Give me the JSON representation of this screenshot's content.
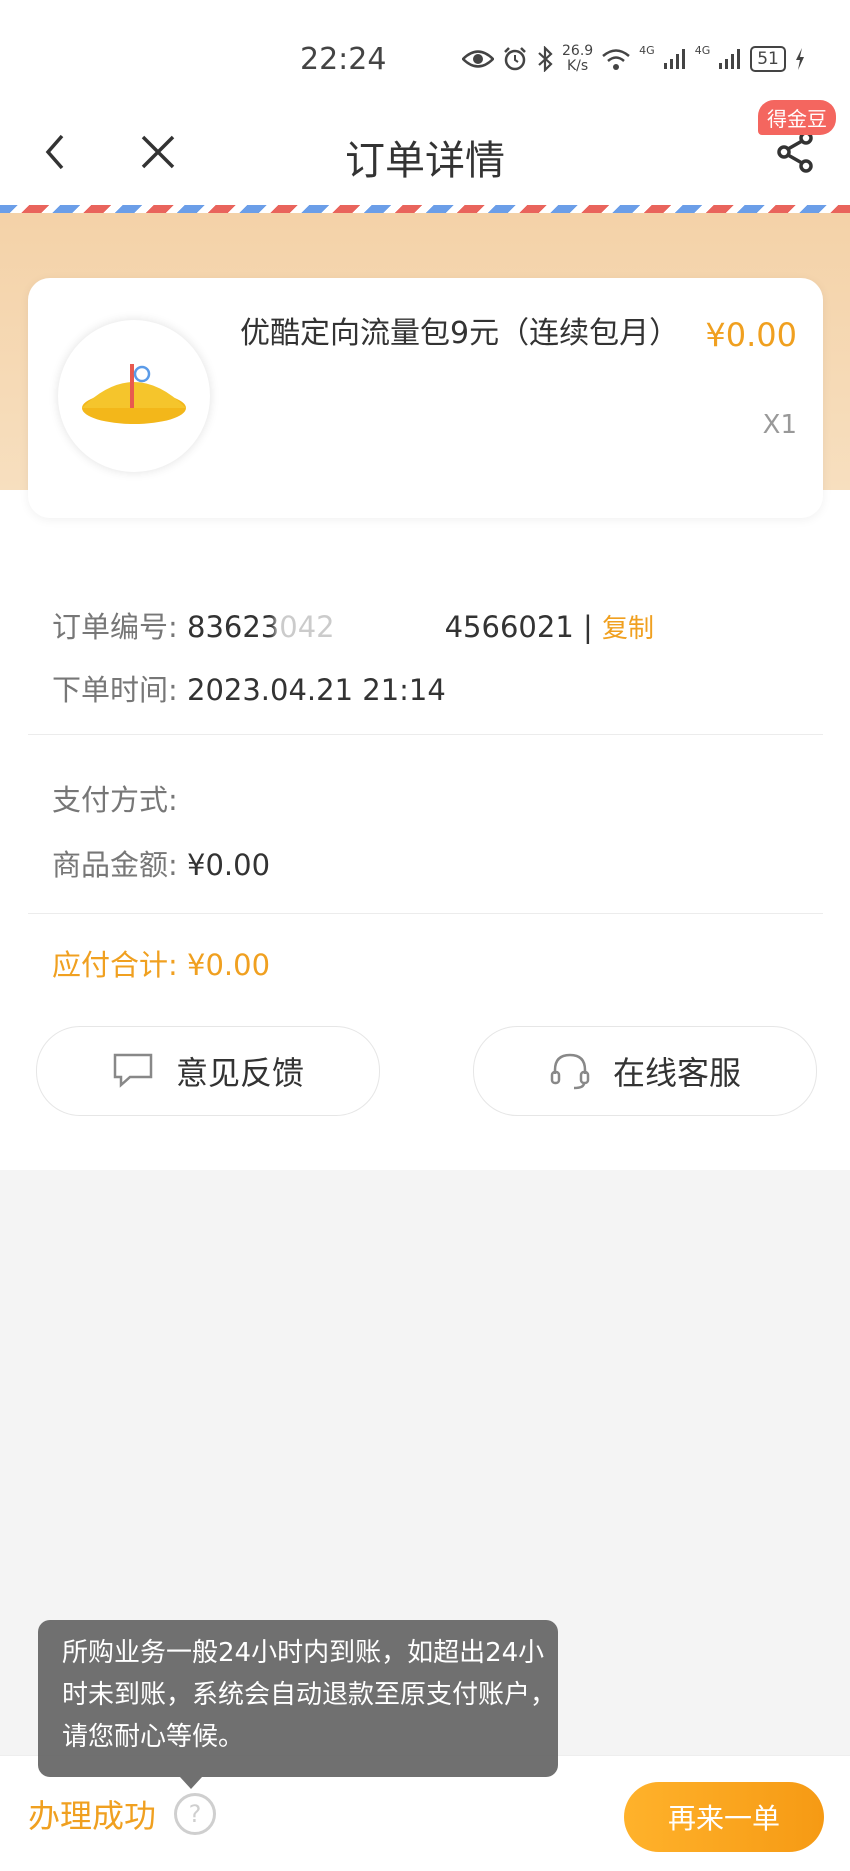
{
  "status_bar": {
    "time": "22:24",
    "speed_value": "26.9",
    "speed_unit": "K/s",
    "net1": "4G",
    "net2": "4G",
    "battery": "51"
  },
  "header": {
    "title": "订单详情",
    "badge": "得金豆"
  },
  "product": {
    "name": "优酷定向流量包9元（连续包月）",
    "price": "¥0.00",
    "quantity": "X1"
  },
  "order": {
    "number_label": "订单编号:",
    "number_head": "83623042",
    "number_tail": "4566021",
    "separator": "|",
    "copy_label": "复制",
    "time_label": "下单时间:",
    "time_value": "2023.04.21 21:14"
  },
  "payment": {
    "method_label": "支付方式:",
    "method_value": "",
    "amount_label": "商品金额:",
    "amount_value": "¥0.00"
  },
  "total": {
    "label": "应付合计:",
    "value": "¥0.00"
  },
  "actions": {
    "feedback_label": "意见反馈",
    "service_label": "在线客服"
  },
  "tooltip": {
    "text": "所购业务一般24小时内到账，如超出24小时未到账，系统会自动退款至原支付账户，请您耐心等候。"
  },
  "footer": {
    "status": "办理成功",
    "help": "?",
    "reorder_label": "再来一单"
  },
  "colors": {
    "accent": "#f0a020",
    "badge": "#f4665f"
  }
}
